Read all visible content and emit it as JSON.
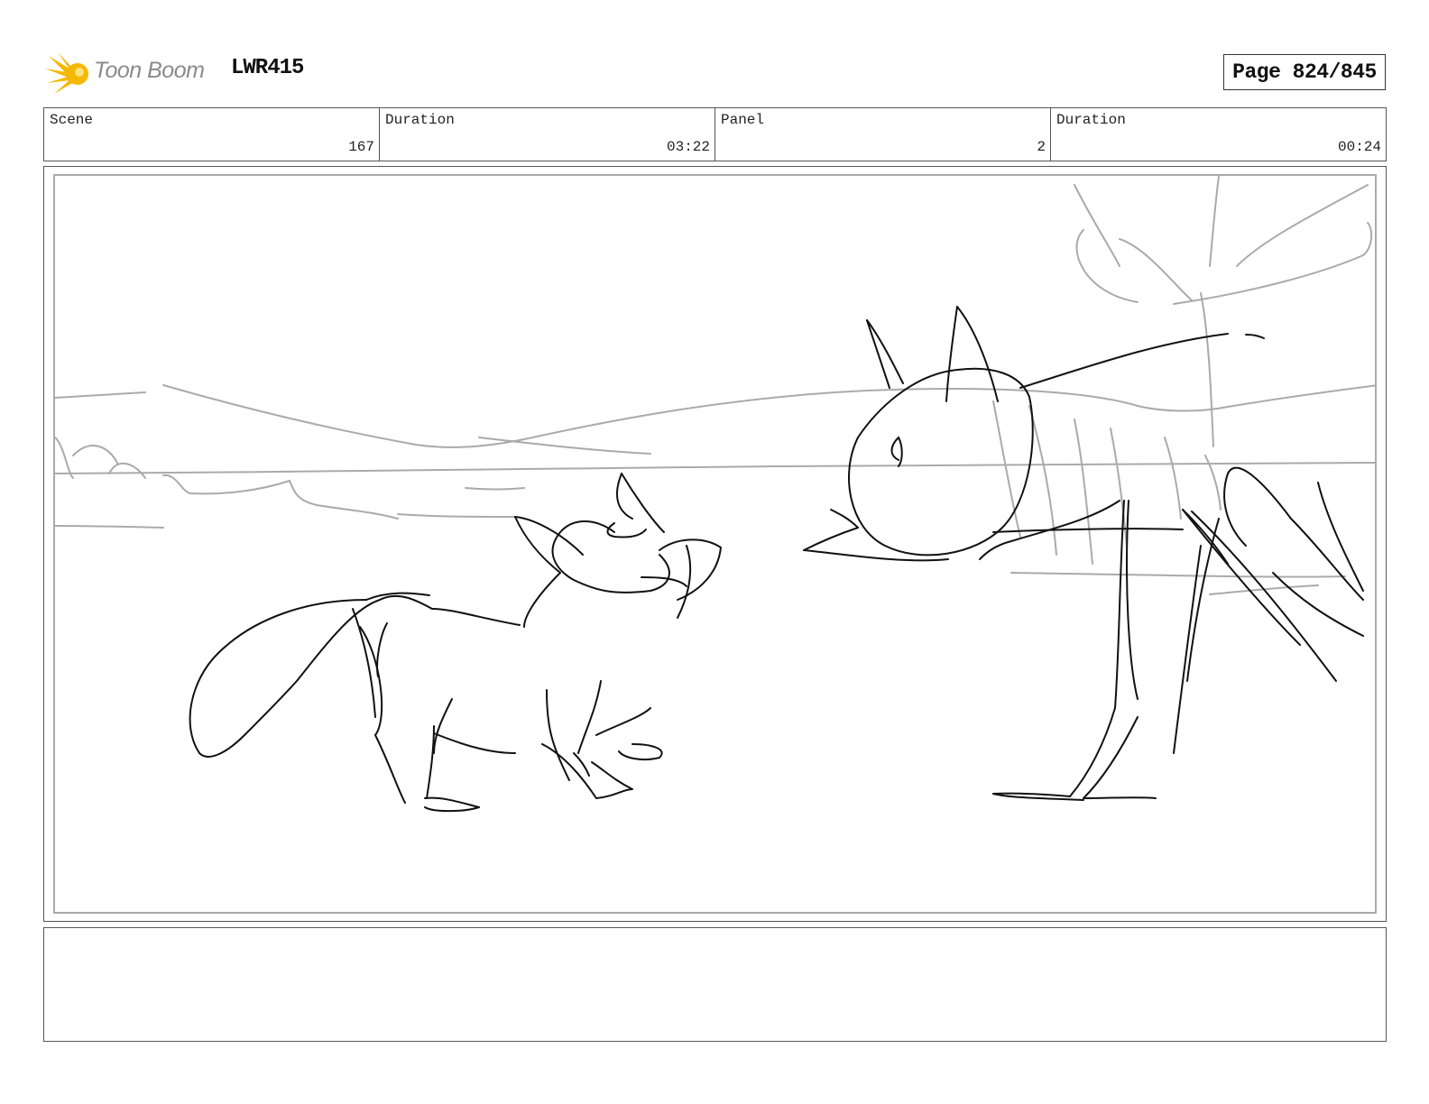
{
  "header": {
    "logo_text": "Toon Boom",
    "project_code": "LWR415",
    "page_label": "Page 824/845"
  },
  "info_bar": [
    {
      "label": "Scene",
      "value": "167"
    },
    {
      "label": "Duration",
      "value": "03:22"
    },
    {
      "label": "Panel",
      "value": "2"
    },
    {
      "label": "Duration",
      "value": "00:24"
    }
  ],
  "panel": {
    "image_description": "",
    "colors": {
      "sketch_line": "#111111",
      "background_line": "#aaaaaa",
      "logo_accent": "#f5b800"
    }
  },
  "notes": {
    "text": ""
  }
}
